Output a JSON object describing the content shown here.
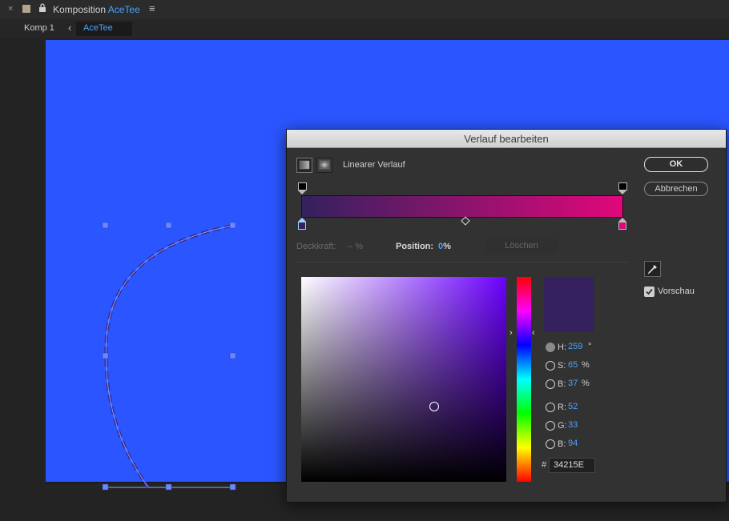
{
  "header": {
    "close": "×",
    "comp_prefix": "Komposition",
    "comp_name": "AceTee",
    "menu": "≡"
  },
  "breadcrumb": {
    "root": "Komp 1",
    "arrow": "‹",
    "current": "AceTee"
  },
  "canvas": {
    "color": "#2b56ff"
  },
  "dialog": {
    "title": "Verlauf bearbeiten",
    "ok": "OK",
    "cancel": "Abbrechen",
    "type_label": "Linearer Verlauf",
    "opacity_label": "Deckkraft:",
    "opacity_value": "-- %",
    "position_label": "Position:",
    "position_value": "0",
    "position_unit": "%",
    "delete": "Löschen",
    "preview_label": "Vorschau",
    "gradient": {
      "start": "#34215e",
      "end": "#e0077a"
    },
    "color": {
      "H": {
        "label": "H:",
        "value": "259",
        "unit": "°"
      },
      "S": {
        "label": "S:",
        "value": "65",
        "unit": "%"
      },
      "Bv": {
        "label": "B:",
        "value": "37",
        "unit": "%"
      },
      "R": {
        "label": "R:",
        "value": "52"
      },
      "G": {
        "label": "G:",
        "value": "33"
      },
      "Bc": {
        "label": "B:",
        "value": "94"
      },
      "hash": "#",
      "hex": "34215E"
    }
  }
}
